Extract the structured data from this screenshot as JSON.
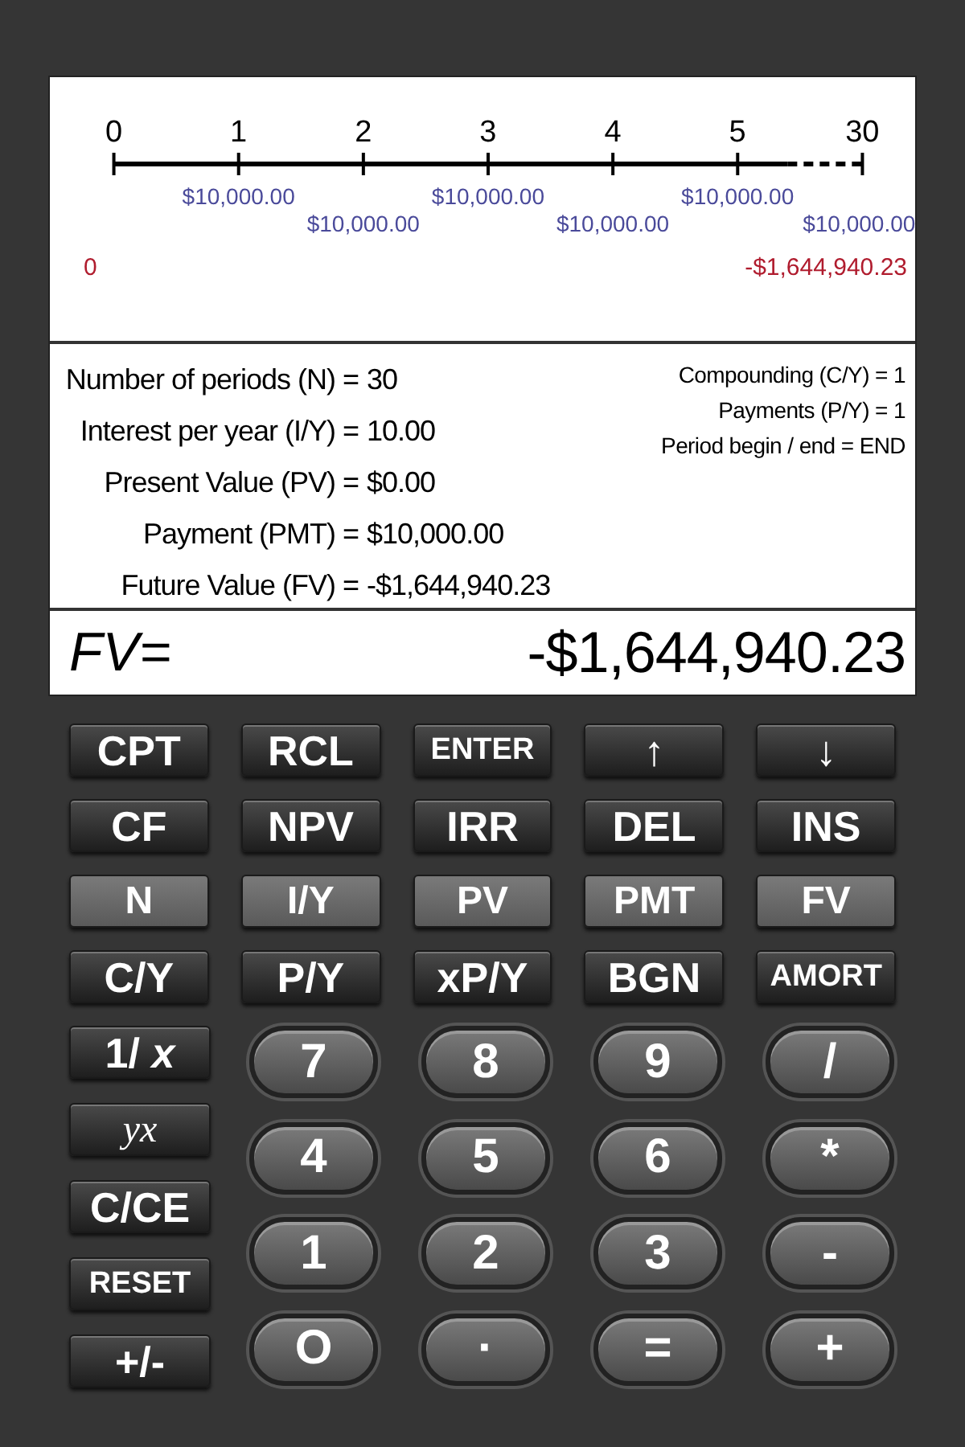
{
  "timeline": {
    "periods": [
      "0",
      "1",
      "2",
      "3",
      "4",
      "5",
      "30"
    ],
    "payments": [
      "$10,000.00",
      "$10,000.00",
      "$10,000.00",
      "$10,000.00",
      "$10,000.00",
      "$10,000.00"
    ],
    "present_value": "0",
    "future_value": "-$1,644,940.23"
  },
  "inputs": [
    {
      "label": "Number of periods (N) =",
      "value": "30"
    },
    {
      "label": "Interest per year (I/Y) =",
      "value": "10.00"
    },
    {
      "label": "Present Value (PV) =",
      "value": "$0.00"
    },
    {
      "label": "Payment (PMT) =",
      "value": "$10,000.00"
    },
    {
      "label": "Future Value (FV) =",
      "value": "-$1,644,940.23"
    }
  ],
  "settings": [
    "Compounding (C/Y) = 1",
    "Payments (P/Y) = 1",
    "Period begin / end = END"
  ],
  "display": {
    "label": "FV=",
    "value": "-$1,644,940.23"
  },
  "top_keys": [
    {
      "label": "CPT",
      "kind": "function"
    },
    {
      "label": "RCL",
      "kind": "function"
    },
    {
      "label": "ENTER",
      "kind": "small"
    },
    {
      "label": "↑",
      "kind": "function"
    },
    {
      "label": "↓",
      "kind": "function"
    },
    {
      "label": "CF",
      "kind": "function"
    },
    {
      "label": "NPV",
      "kind": "function"
    },
    {
      "label": "IRR",
      "kind": "function"
    },
    {
      "label": "DEL",
      "kind": "function"
    },
    {
      "label": "INS",
      "kind": "function"
    },
    {
      "label": "N",
      "kind": "variable"
    },
    {
      "label": "I/Y",
      "kind": "variable"
    },
    {
      "label": "PV",
      "kind": "variable"
    },
    {
      "label": "PMT",
      "kind": "variable"
    },
    {
      "label": "FV",
      "kind": "variable"
    },
    {
      "label": "C/Y",
      "kind": "function"
    },
    {
      "label": "P/Y",
      "kind": "function"
    },
    {
      "label": "xP/Y",
      "kind": "function"
    },
    {
      "label": "BGN",
      "kind": "function"
    },
    {
      "label": "AMORT",
      "kind": "small"
    }
  ],
  "side_keys": [
    {
      "label": "1/ *x*",
      "kind": "function"
    },
    {
      "label": "yx",
      "kind": "formula"
    },
    {
      "label": "C/CE",
      "kind": "function"
    },
    {
      "label": "RESET",
      "kind": "small"
    },
    {
      "label": "+/-",
      "kind": "function"
    }
  ],
  "keypad": [
    "7",
    "8",
    "9",
    "/",
    "4",
    "5",
    "6",
    "*",
    "1",
    "2",
    "3",
    "-",
    "O",
    "·",
    "=",
    "+"
  ]
}
